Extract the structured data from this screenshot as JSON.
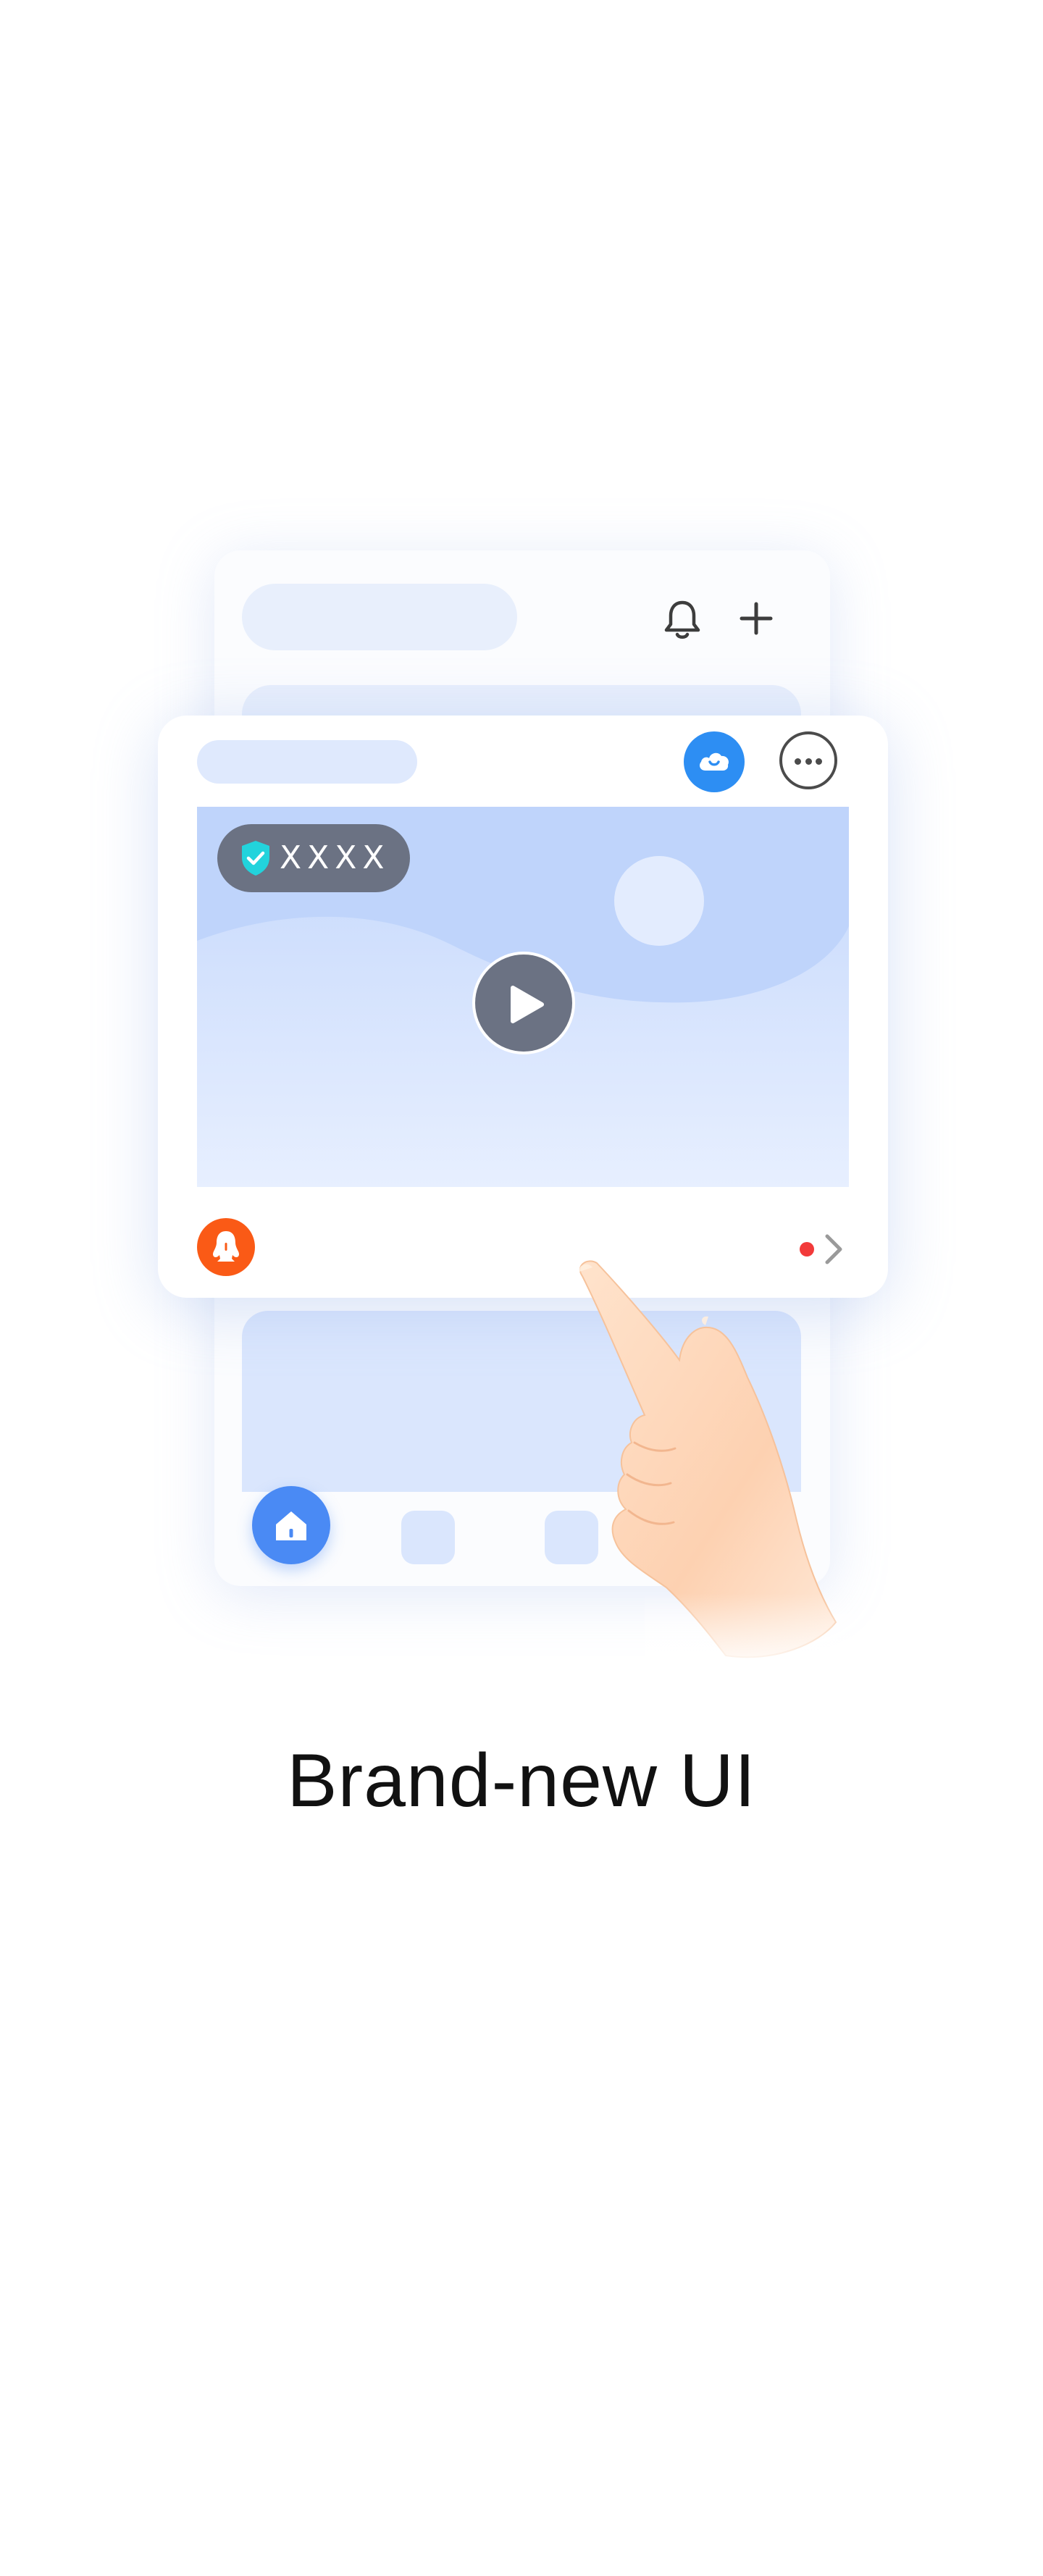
{
  "illustration": {
    "video_badge_text": "XXXX",
    "icons": {
      "notification": "bell-icon",
      "add": "plus-icon",
      "cloud": "cloud-icon",
      "more": "more-horizontal-icon",
      "verified": "shield-check-icon",
      "play": "play-icon",
      "alert": "qq-penguin-icon",
      "chevron": "chevron-right-icon",
      "home": "home-icon",
      "hand": "pointing-hand-icon"
    },
    "colors": {
      "accent_blue": "#2d8ef3",
      "nav_blue": "#4a8af4",
      "alert_orange": "#fa5a16",
      "notification_red": "#f23a3a",
      "badge_gray": "#6b7283",
      "shield_cyan": "#22d3dc",
      "placeholder_blue": "#e8effc"
    }
  },
  "headline": {
    "text": "Brand-new UI"
  }
}
